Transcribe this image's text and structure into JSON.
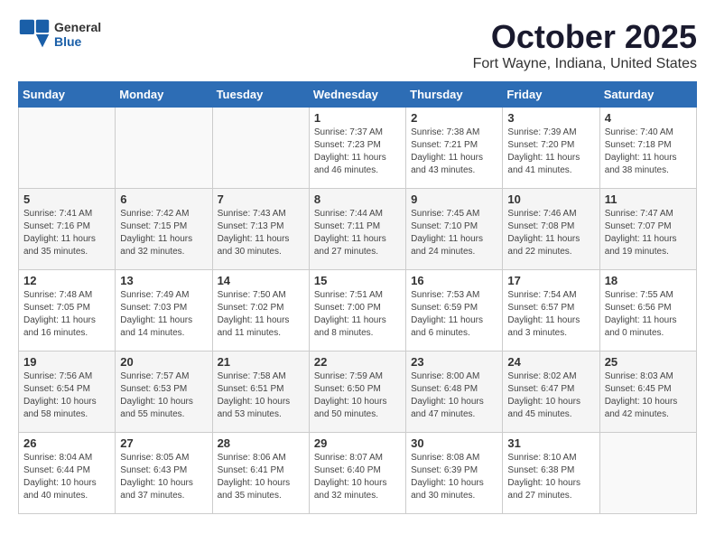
{
  "header": {
    "logo_general": "General",
    "logo_blue": "Blue",
    "month": "October 2025",
    "location": "Fort Wayne, Indiana, United States"
  },
  "calendar": {
    "days_of_week": [
      "Sunday",
      "Monday",
      "Tuesday",
      "Wednesday",
      "Thursday",
      "Friday",
      "Saturday"
    ],
    "weeks": [
      [
        {
          "day": "",
          "info": ""
        },
        {
          "day": "",
          "info": ""
        },
        {
          "day": "",
          "info": ""
        },
        {
          "day": "1",
          "info": "Sunrise: 7:37 AM\nSunset: 7:23 PM\nDaylight: 11 hours\nand 46 minutes."
        },
        {
          "day": "2",
          "info": "Sunrise: 7:38 AM\nSunset: 7:21 PM\nDaylight: 11 hours\nand 43 minutes."
        },
        {
          "day": "3",
          "info": "Sunrise: 7:39 AM\nSunset: 7:20 PM\nDaylight: 11 hours\nand 41 minutes."
        },
        {
          "day": "4",
          "info": "Sunrise: 7:40 AM\nSunset: 7:18 PM\nDaylight: 11 hours\nand 38 minutes."
        }
      ],
      [
        {
          "day": "5",
          "info": "Sunrise: 7:41 AM\nSunset: 7:16 PM\nDaylight: 11 hours\nand 35 minutes."
        },
        {
          "day": "6",
          "info": "Sunrise: 7:42 AM\nSunset: 7:15 PM\nDaylight: 11 hours\nand 32 minutes."
        },
        {
          "day": "7",
          "info": "Sunrise: 7:43 AM\nSunset: 7:13 PM\nDaylight: 11 hours\nand 30 minutes."
        },
        {
          "day": "8",
          "info": "Sunrise: 7:44 AM\nSunset: 7:11 PM\nDaylight: 11 hours\nand 27 minutes."
        },
        {
          "day": "9",
          "info": "Sunrise: 7:45 AM\nSunset: 7:10 PM\nDaylight: 11 hours\nand 24 minutes."
        },
        {
          "day": "10",
          "info": "Sunrise: 7:46 AM\nSunset: 7:08 PM\nDaylight: 11 hours\nand 22 minutes."
        },
        {
          "day": "11",
          "info": "Sunrise: 7:47 AM\nSunset: 7:07 PM\nDaylight: 11 hours\nand 19 minutes."
        }
      ],
      [
        {
          "day": "12",
          "info": "Sunrise: 7:48 AM\nSunset: 7:05 PM\nDaylight: 11 hours\nand 16 minutes."
        },
        {
          "day": "13",
          "info": "Sunrise: 7:49 AM\nSunset: 7:03 PM\nDaylight: 11 hours\nand 14 minutes."
        },
        {
          "day": "14",
          "info": "Sunrise: 7:50 AM\nSunset: 7:02 PM\nDaylight: 11 hours\nand 11 minutes."
        },
        {
          "day": "15",
          "info": "Sunrise: 7:51 AM\nSunset: 7:00 PM\nDaylight: 11 hours\nand 8 minutes."
        },
        {
          "day": "16",
          "info": "Sunrise: 7:53 AM\nSunset: 6:59 PM\nDaylight: 11 hours\nand 6 minutes."
        },
        {
          "day": "17",
          "info": "Sunrise: 7:54 AM\nSunset: 6:57 PM\nDaylight: 11 hours\nand 3 minutes."
        },
        {
          "day": "18",
          "info": "Sunrise: 7:55 AM\nSunset: 6:56 PM\nDaylight: 11 hours\nand 0 minutes."
        }
      ],
      [
        {
          "day": "19",
          "info": "Sunrise: 7:56 AM\nSunset: 6:54 PM\nDaylight: 10 hours\nand 58 minutes."
        },
        {
          "day": "20",
          "info": "Sunrise: 7:57 AM\nSunset: 6:53 PM\nDaylight: 10 hours\nand 55 minutes."
        },
        {
          "day": "21",
          "info": "Sunrise: 7:58 AM\nSunset: 6:51 PM\nDaylight: 10 hours\nand 53 minutes."
        },
        {
          "day": "22",
          "info": "Sunrise: 7:59 AM\nSunset: 6:50 PM\nDaylight: 10 hours\nand 50 minutes."
        },
        {
          "day": "23",
          "info": "Sunrise: 8:00 AM\nSunset: 6:48 PM\nDaylight: 10 hours\nand 47 minutes."
        },
        {
          "day": "24",
          "info": "Sunrise: 8:02 AM\nSunset: 6:47 PM\nDaylight: 10 hours\nand 45 minutes."
        },
        {
          "day": "25",
          "info": "Sunrise: 8:03 AM\nSunset: 6:45 PM\nDaylight: 10 hours\nand 42 minutes."
        }
      ],
      [
        {
          "day": "26",
          "info": "Sunrise: 8:04 AM\nSunset: 6:44 PM\nDaylight: 10 hours\nand 40 minutes."
        },
        {
          "day": "27",
          "info": "Sunrise: 8:05 AM\nSunset: 6:43 PM\nDaylight: 10 hours\nand 37 minutes."
        },
        {
          "day": "28",
          "info": "Sunrise: 8:06 AM\nSunset: 6:41 PM\nDaylight: 10 hours\nand 35 minutes."
        },
        {
          "day": "29",
          "info": "Sunrise: 8:07 AM\nSunset: 6:40 PM\nDaylight: 10 hours\nand 32 minutes."
        },
        {
          "day": "30",
          "info": "Sunrise: 8:08 AM\nSunset: 6:39 PM\nDaylight: 10 hours\nand 30 minutes."
        },
        {
          "day": "31",
          "info": "Sunrise: 8:10 AM\nSunset: 6:38 PM\nDaylight: 10 hours\nand 27 minutes."
        },
        {
          "day": "",
          "info": ""
        }
      ]
    ]
  }
}
